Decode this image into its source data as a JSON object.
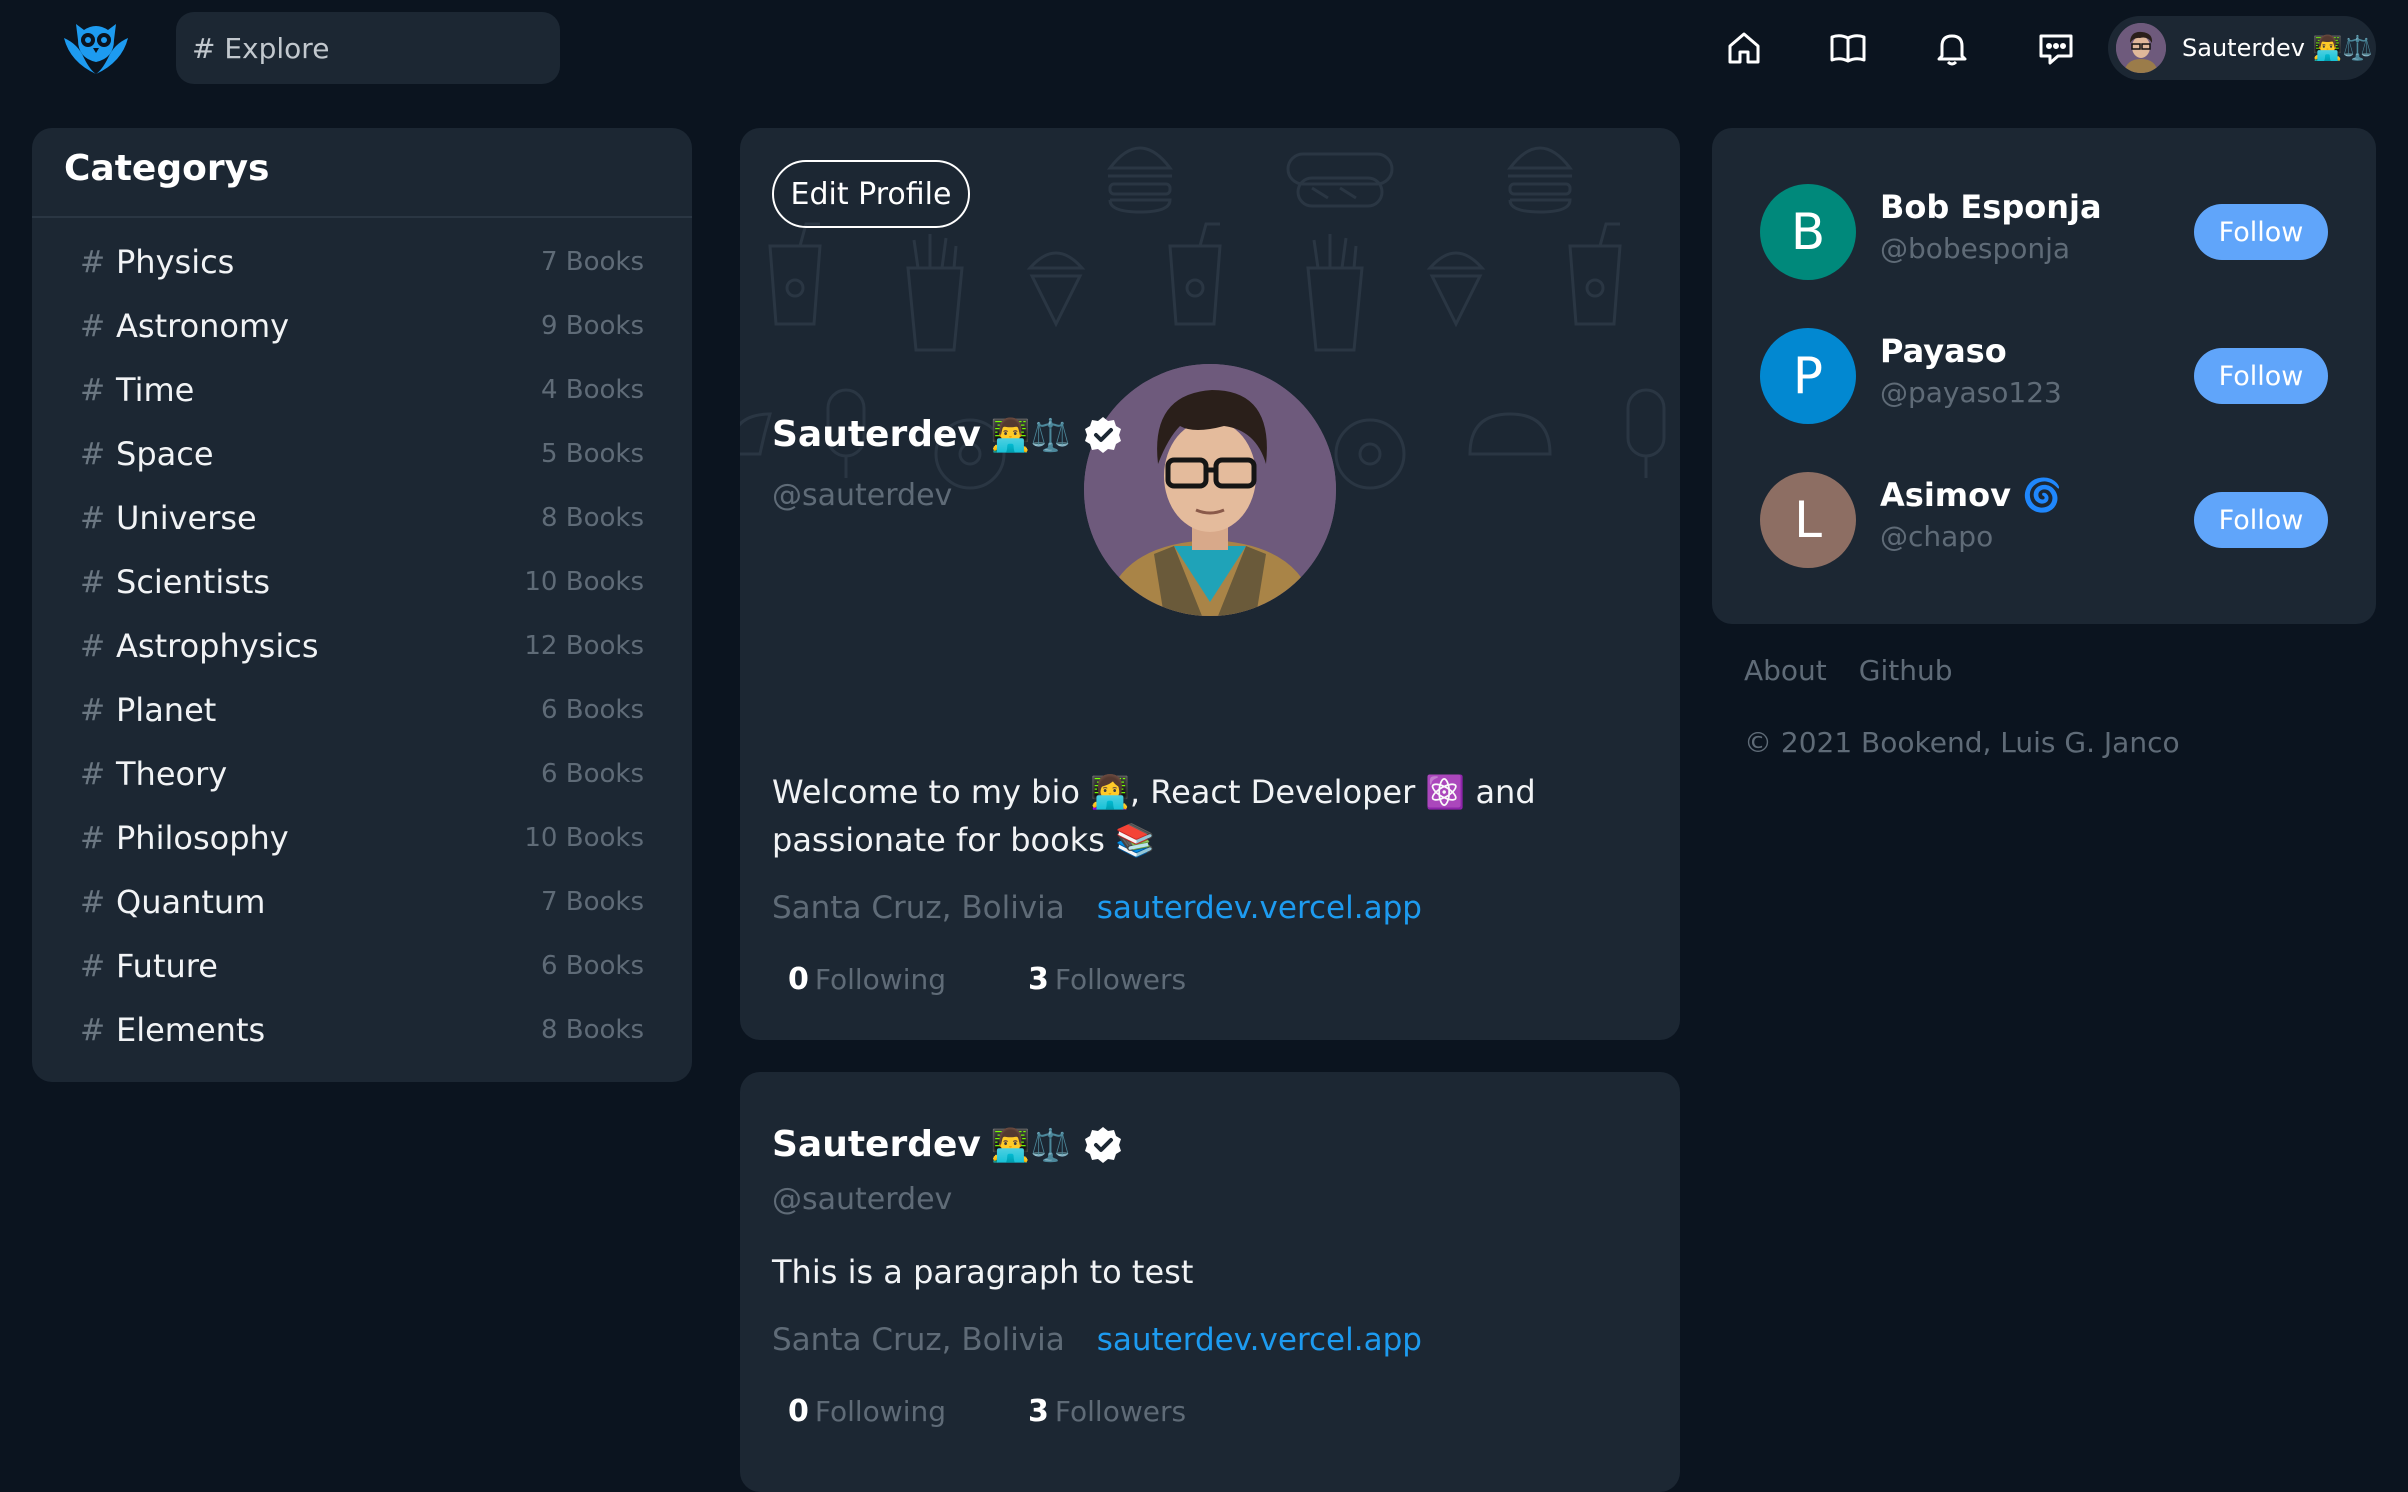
{
  "navbar": {
    "logo_icon": "owl-book-logo-icon",
    "search_placeholder": "# Explore",
    "icons": [
      "home-icon",
      "book-open-icon",
      "bell-icon",
      "message-icon"
    ],
    "user_name": "Sauterdev 👨‍💻⚖️"
  },
  "categories": {
    "title": "Categorys",
    "items": [
      {
        "name": "Physics",
        "count": "7 Books"
      },
      {
        "name": "Astronomy",
        "count": "9 Books"
      },
      {
        "name": "Time",
        "count": "4 Books"
      },
      {
        "name": "Space",
        "count": "5 Books"
      },
      {
        "name": "Universe",
        "count": "8 Books"
      },
      {
        "name": "Scientists",
        "count": "10 Books"
      },
      {
        "name": "Astrophysics",
        "count": "12 Books"
      },
      {
        "name": "Planet",
        "count": "6 Books"
      },
      {
        "name": "Theory",
        "count": "6 Books"
      },
      {
        "name": "Philosophy",
        "count": "10 Books"
      },
      {
        "name": "Quantum",
        "count": "7 Books"
      },
      {
        "name": "Future",
        "count": "6 Books"
      },
      {
        "name": "Elements",
        "count": "8 Books"
      }
    ]
  },
  "profile": {
    "edit_label": "Edit Profile",
    "name": "Sauterdev",
    "name_emoji": "👨‍💻⚖️",
    "handle": "@sauterdev",
    "bio_line1": "Welcome to my bio 👩‍💻, React Developer ⚛️ and",
    "bio_line2": "passionate for books 📚",
    "location": "Santa Cruz, Bolivia",
    "website": "sauterdev.vercel.app",
    "following_count": "0",
    "following_label": "Following",
    "followers_count": "3",
    "followers_label": "Followers"
  },
  "post": {
    "name": "Sauterdev",
    "name_emoji": "👨‍💻⚖️",
    "handle": "@sauterdev",
    "text": "This is a paragraph to test",
    "location": "Santa Cruz, Bolivia",
    "website": "sauterdev.vercel.app",
    "following_count": "0",
    "following_label": "Following",
    "followers_count": "3",
    "followers_label": "Followers"
  },
  "suggestions": [
    {
      "initial": "B",
      "name": "Bob Esponja",
      "handle": "@bobesponja",
      "color": "#00897b",
      "follow": "Follow"
    },
    {
      "initial": "P",
      "name": "Payaso",
      "handle": "@payaso123",
      "color": "#0288d1",
      "follow": "Follow"
    },
    {
      "initial": "L",
      "name": "Asimov 🌀",
      "handle": "@chapo",
      "color": "#8d6e63",
      "follow": "Follow"
    }
  ],
  "footer": {
    "links": [
      "About",
      "Github"
    ],
    "copyright": "© 2021 Bookend, Luis G. Janco"
  },
  "colors": {
    "background": "#0b141f",
    "card": "#1c2733",
    "accent": "#60a5fa",
    "link": "#1d9bf0",
    "muted": "#5f6b77"
  }
}
